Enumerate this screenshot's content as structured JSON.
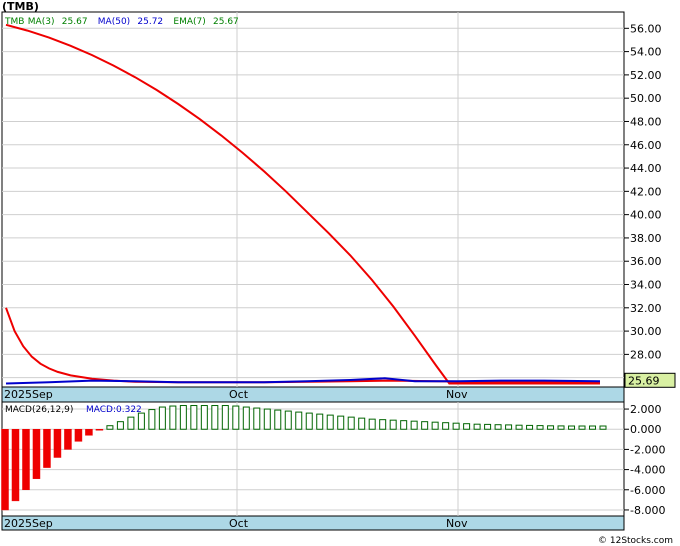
{
  "title": "(TMB)",
  "price_panel": {
    "legend": [
      {
        "label": "TMB",
        "value": "",
        "color": "#008000"
      },
      {
        "label": "MA(3)",
        "value": "25.67",
        "color": "#008000"
      },
      {
        "label": "MA(50)",
        "value": "25.72",
        "color": "#0000cc"
      },
      {
        "label": "EMA(7)",
        "value": "25.67",
        "color": "#008000"
      }
    ],
    "price_tag": "25.69"
  },
  "macd_panel": {
    "label": "MACD(26,12,9)",
    "value_label": "MACD:0.322"
  },
  "x_labels": [
    "2025Sep",
    "Oct",
    "Nov"
  ],
  "watermark": "© 12Stocks.com",
  "chart_data": [
    {
      "type": "line",
      "title": "(TMB)",
      "ylim": [
        25.2,
        57.4
      ],
      "yticks": [
        26,
        28,
        30,
        32,
        34,
        36,
        38,
        40,
        42,
        44,
        46,
        48,
        50,
        52,
        54,
        56
      ],
      "series": [
        {
          "name": "MA(50)",
          "color": "#ee0000",
          "points": [
            [
              0,
              56.3
            ],
            [
              5,
              55.8
            ],
            [
              10,
              55.2
            ],
            [
              15,
              54.5
            ],
            [
              20,
              53.7
            ],
            [
              25,
              52.8
            ],
            [
              30,
              51.8
            ],
            [
              35,
              50.7
            ],
            [
              40,
              49.5
            ],
            [
              45,
              48.2
            ],
            [
              50,
              46.8
            ],
            [
              55,
              45.3
            ],
            [
              60,
              43.7
            ],
            [
              65,
              42.0
            ],
            [
              70,
              40.2
            ],
            [
              75,
              38.4
            ],
            [
              80,
              36.5
            ],
            [
              85,
              34.4
            ],
            [
              90,
              32.1
            ],
            [
              95,
              29.6
            ],
            [
              100,
              27.0
            ],
            [
              103,
              25.5
            ],
            [
              110,
              25.5
            ],
            [
              120,
              25.5
            ],
            [
              130,
              25.5
            ],
            [
              138,
              25.5
            ]
          ]
        },
        {
          "name": "EMA(7)",
          "color": "#ee0000",
          "points": [
            [
              0,
              32.0
            ],
            [
              2,
              30.0
            ],
            [
              4,
              28.7
            ],
            [
              6,
              27.8
            ],
            [
              8,
              27.2
            ],
            [
              10,
              26.8
            ],
            [
              12,
              26.5
            ],
            [
              15,
              26.2
            ],
            [
              20,
              25.9
            ],
            [
              25,
              25.75
            ],
            [
              30,
              25.65
            ],
            [
              40,
              25.6
            ],
            [
              50,
              25.6
            ],
            [
              60,
              25.6
            ],
            [
              70,
              25.65
            ],
            [
              80,
              25.7
            ],
            [
              90,
              25.75
            ],
            [
              100,
              25.7
            ],
            [
              110,
              25.65
            ],
            [
              120,
              25.65
            ],
            [
              130,
              25.6
            ],
            [
              138,
              25.6
            ]
          ]
        },
        {
          "name": "TMB",
          "color": "#0000cc",
          "points": [
            [
              0,
              25.5
            ],
            [
              10,
              25.6
            ],
            [
              20,
              25.75
            ],
            [
              30,
              25.7
            ],
            [
              40,
              25.6
            ],
            [
              50,
              25.6
            ],
            [
              60,
              25.6
            ],
            [
              70,
              25.7
            ],
            [
              80,
              25.8
            ],
            [
              88,
              25.95
            ],
            [
              95,
              25.7
            ],
            [
              105,
              25.7
            ],
            [
              115,
              25.75
            ],
            [
              125,
              25.75
            ],
            [
              138,
              25.7
            ]
          ]
        }
      ]
    },
    {
      "type": "bar",
      "title": "MACD(26,12,9)",
      "ylim": [
        -8.6,
        2.7
      ],
      "yticks": [
        2.0,
        0.0,
        -2.0,
        -4.0,
        -6.0,
        -8.0
      ],
      "values": [
        -8.0,
        -7.1,
        -6.0,
        -4.9,
        -3.8,
        -2.8,
        -2.0,
        -1.2,
        -0.6,
        -0.1,
        0.35,
        0.75,
        1.2,
        1.6,
        1.95,
        2.2,
        2.3,
        2.35,
        2.35,
        2.35,
        2.35,
        2.35,
        2.3,
        2.2,
        2.1,
        2.0,
        1.9,
        1.8,
        1.7,
        1.6,
        1.5,
        1.4,
        1.3,
        1.2,
        1.1,
        1.0,
        0.95,
        0.9,
        0.85,
        0.8,
        0.75,
        0.7,
        0.65,
        0.6,
        0.55,
        0.5,
        0.48,
        0.45,
        0.43,
        0.4,
        0.38,
        0.36,
        0.34,
        0.33,
        0.32,
        0.32,
        0.32,
        0.32
      ]
    }
  ]
}
